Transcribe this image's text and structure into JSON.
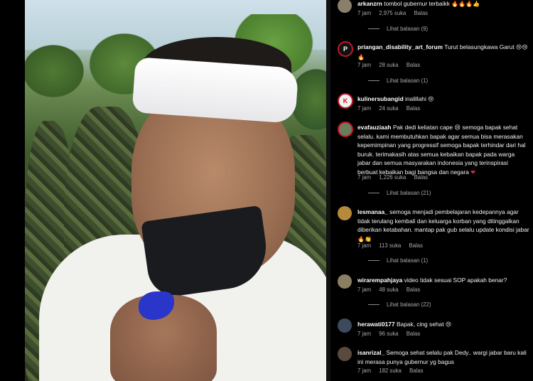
{
  "comments": [
    {
      "username": "arkanzrn",
      "text": "tombol gubernur terbaikk",
      "emoji": "🔥🔥🔥👍",
      "time": "7 jam",
      "likes": "2,975 suka",
      "reply_label": "Balas",
      "view_replies": "Lihat balasan (9)",
      "avatar_color": "#8a7f6a",
      "avatar_text": ""
    },
    {
      "username": "priangan_disability_art_forum",
      "text": "Turut belasungkawa Garut",
      "emoji": "😢😢🔥",
      "time": "7 jam",
      "likes": "28 suka",
      "reply_label": "Balas",
      "view_replies": "Lihat balasan (1)",
      "avatar_color": "#111111",
      "avatar_text": "P"
    },
    {
      "username": "kulinersubangid",
      "text": "inalillahi",
      "emoji": "😢",
      "time": "7 jam",
      "likes": "24 suka",
      "reply_label": "Balas",
      "avatar_color": "#e8e8e8",
      "avatar_text": "K"
    },
    {
      "username": "evafauziaah",
      "text": "Pak dedi keliatan cape 😢 semoga bapak sehat selalu. kami membutuhkan bapak agar semua bisa merasakan kepemimpinan yang progressif semoga bapak terhindar dari hal buruk. terimakasih atas semua kebaikan bapak pada warga jabar dan semua masyarakan indonesia yang terinspirasi berbuat kebaikan bagi bangsa dan negara",
      "emoji": "❤",
      "time": "7 jam",
      "likes": "1,226 suka",
      "reply_label": "Balas",
      "view_replies": "Lihat balasan (21)",
      "avatar_color": "#6b7d5a",
      "avatar_text": ""
    },
    {
      "username": "lesmanaa_",
      "text": "semoga menjadi pembelajaran kedepannya agar tidak terulang kembali dan keluarga korban yang ditinggalkan diberikan ketabahan. mantap pak gub selalu update kondisi jabar",
      "emoji": "🔥👏",
      "time": "7 jam",
      "likes": "113 suka",
      "reply_label": "Balas",
      "view_replies": "Lihat balasan (1)",
      "avatar_color": "#b58a3c",
      "avatar_text": ""
    },
    {
      "username": "wirarempahjaya",
      "text": "video tidak sesuai SOP apakah benar?",
      "emoji": "",
      "time": "7 jam",
      "likes": "48 suka",
      "reply_label": "Balas",
      "view_replies": "Lihat balasan (22)",
      "avatar_color": "#8c7e63",
      "avatar_text": ""
    },
    {
      "username": "herawati0177",
      "text": "Bapak, cing sehat",
      "emoji": "😢",
      "time": "7 jam",
      "likes": "96 suka",
      "reply_label": "Balas",
      "avatar_color": "#3d4a5c",
      "avatar_text": ""
    },
    {
      "username": "isanrizal_",
      "text": "Semoga sehat selalu pak Dedy.. wargi jabar baru kali ini merasa punya gubernur yg bagus",
      "emoji": "",
      "time": "7 jam",
      "likes": "182 suka",
      "reply_label": "Balas",
      "avatar_color": "#5a4a3e",
      "avatar_text": ""
    }
  ]
}
